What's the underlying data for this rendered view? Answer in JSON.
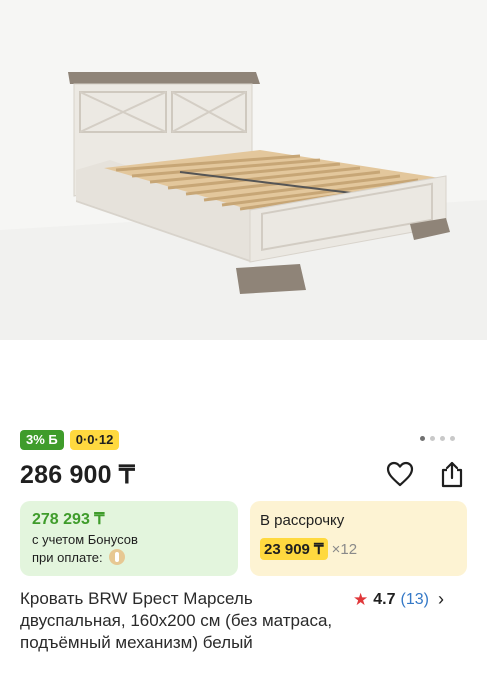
{
  "gallery": {
    "slide_count": 4,
    "active_slide": 1
  },
  "badges": {
    "bonus_percent": "3% Б",
    "installment_code": "0·0·12"
  },
  "product": {
    "price": "286 900 ₸",
    "title": "Кровать BRW Брест Марсель двуспальная, 160x200 см (без матраса, подъёмный механизм) белый"
  },
  "bonus_card": {
    "price": "278 293 ₸",
    "line1": "с учетом Бонусов",
    "line2": "при оплате:"
  },
  "installment_card": {
    "label": "В рассрочку",
    "amount": "23 909 ₸",
    "term": "×12"
  },
  "rating": {
    "value": "4.7",
    "count": "(13)"
  },
  "colors": {
    "green": "#3f9c2b",
    "yellow": "#ffd93f",
    "bonus_bg": "#e3f5dd",
    "installment_bg": "#fdf3d3",
    "star": "#e0373a",
    "link": "#3579c7"
  },
  "icons": [
    "heart-icon",
    "share-icon",
    "star-icon",
    "chevron-right-icon",
    "bonus-coin-icon"
  ]
}
